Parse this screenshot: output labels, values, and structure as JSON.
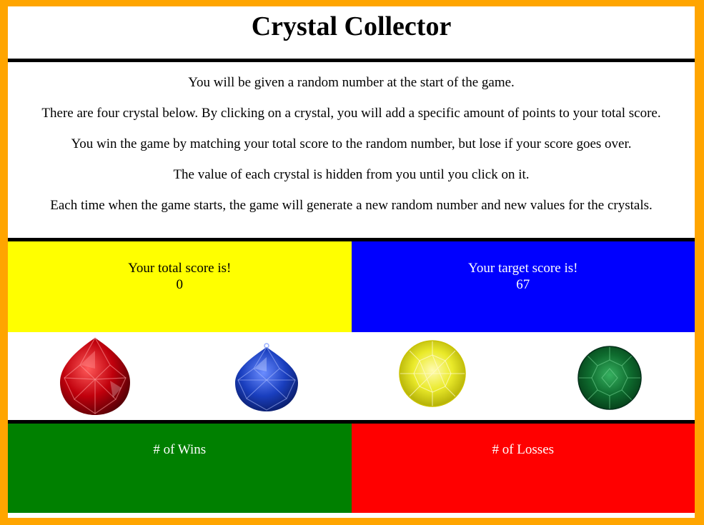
{
  "title": "Crystal Collector",
  "instructions": [
    "You will be given a random number at the start of the game.",
    "There are four crystal below. By clicking on a crystal, you will add a specific amount of points to your total score.",
    "You win the game by matching your total score to the random number, but lose if your score goes over.",
    "The value of each crystal is hidden from you until you click on it.",
    "Each time when the game starts, the game will generate a new random number and new values for the crystals."
  ],
  "total_score": {
    "label": "Your total score is!",
    "value": "0"
  },
  "target_score": {
    "label": "Your target score is!",
    "value": "67"
  },
  "crystals": [
    {
      "name": "red-crystal-icon",
      "color": "#c0000c"
    },
    {
      "name": "blue-crystal-icon",
      "color": "#1a3fbf"
    },
    {
      "name": "yellow-crystal-icon",
      "color": "#eaea2a"
    },
    {
      "name": "green-crystal-icon",
      "color": "#0e6b2e"
    }
  ],
  "wins": {
    "label": "# of Wins"
  },
  "losses": {
    "label": "# of Losses"
  },
  "colors": {
    "border": "#ffa500",
    "total_bg": "#ffff00",
    "target_bg": "#0000ff",
    "wins_bg": "#008000",
    "losses_bg": "#ff0000"
  }
}
